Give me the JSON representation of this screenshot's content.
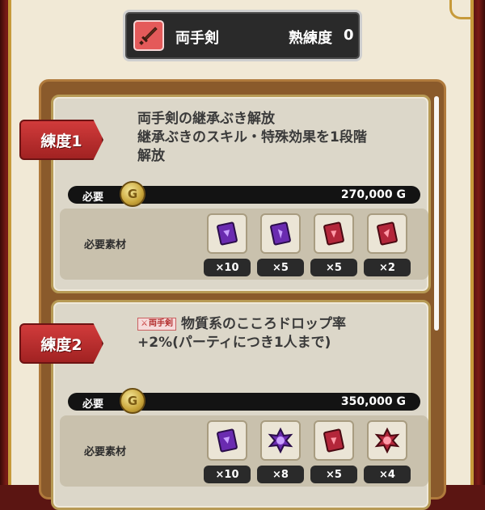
{
  "header": {
    "weapon_name": "両手剣",
    "proficiency_label": "熟練度",
    "proficiency_value": "0",
    "colors": {
      "icon_bg": "#e45a5a",
      "panel_bg": "#2a2a2a"
    }
  },
  "tiers": [
    {
      "badge": "練度1",
      "description_lines": [
        "両手剣の継承ぶき解放",
        "継承ぶきのスキル・特殊効果を1段階",
        "解放"
      ],
      "need_label": "必要",
      "coin_symbol": "G",
      "cost": "270,000 G",
      "materials_label": "必要素材",
      "materials": [
        {
          "icon": "purple-card",
          "count": "×10"
        },
        {
          "icon": "purple-card",
          "count": "×5"
        },
        {
          "icon": "red-card",
          "count": "×5"
        },
        {
          "icon": "red-card",
          "count": "×2"
        }
      ]
    },
    {
      "badge": "練度2",
      "tag": "両手剣",
      "description_lines": [
        "物質系のこころドロップ率",
        "+2%(パーティにつき1人まで)"
      ],
      "need_label": "必要",
      "coin_symbol": "G",
      "cost": "350,000 G",
      "materials_label": "必要素材",
      "materials": [
        {
          "icon": "purple-card",
          "count": "×10"
        },
        {
          "icon": "purple-gem",
          "count": "×8"
        },
        {
          "icon": "red-card",
          "count": "×5"
        },
        {
          "icon": "red-gem",
          "count": "×4"
        }
      ]
    }
  ]
}
